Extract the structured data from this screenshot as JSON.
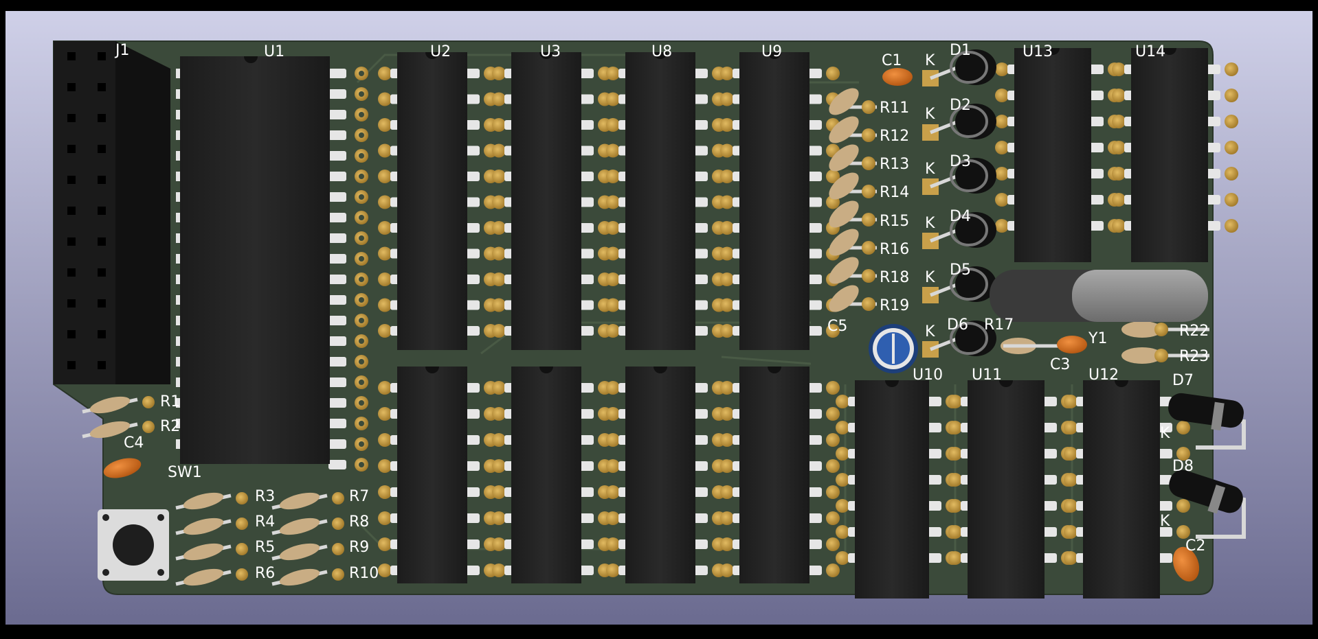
{
  "colors": {
    "bg_top": "#cfd0e8",
    "bg_bottom": "#6b6b90",
    "frame": "#000000",
    "pcb": "#3a4a3a",
    "pcb_dark": "#2e3b2e",
    "silkscreen": "#ffffff",
    "pad_gold": "#c9a04a",
    "chip_body": "#242424",
    "pin_silver": "#e6e6e6",
    "cap_orange": "#d9711a",
    "electrolytic_blue": "#2f5fb0",
    "resistor_body": "#c9ad84",
    "crystal_silver": "#8a8a8a"
  },
  "labels": {
    "J1": "J1",
    "U1": "U1",
    "U2": "U2",
    "U3": "U3",
    "U8": "U8",
    "U9": "U9",
    "U13": "U13",
    "U14": "U14",
    "U10": "U10",
    "U11": "U11",
    "U12": "U12",
    "C1": "C1",
    "C2": "C2",
    "C3": "C3",
    "C4": "C4",
    "C5": "C5",
    "D1": "D1",
    "D2": "D2",
    "D3": "D3",
    "D4": "D4",
    "D5": "D5",
    "D6": "D6",
    "D7": "D7",
    "D8": "D8",
    "K": "K",
    "R1": "R1",
    "R2": "R2",
    "R3": "R3",
    "R4": "R4",
    "R5": "R5",
    "R6": "R6",
    "R7": "R7",
    "R8": "R8",
    "R9": "R9",
    "R10": "R10",
    "R11": "R11",
    "R12": "R12",
    "R13": "R13",
    "R14": "R14",
    "R15": "R15",
    "R16": "R16",
    "R17": "R17",
    "R18": "R18",
    "R19": "R19",
    "R22": "R22",
    "R23": "R23",
    "SW1": "SW1",
    "Y1": "Y1"
  }
}
